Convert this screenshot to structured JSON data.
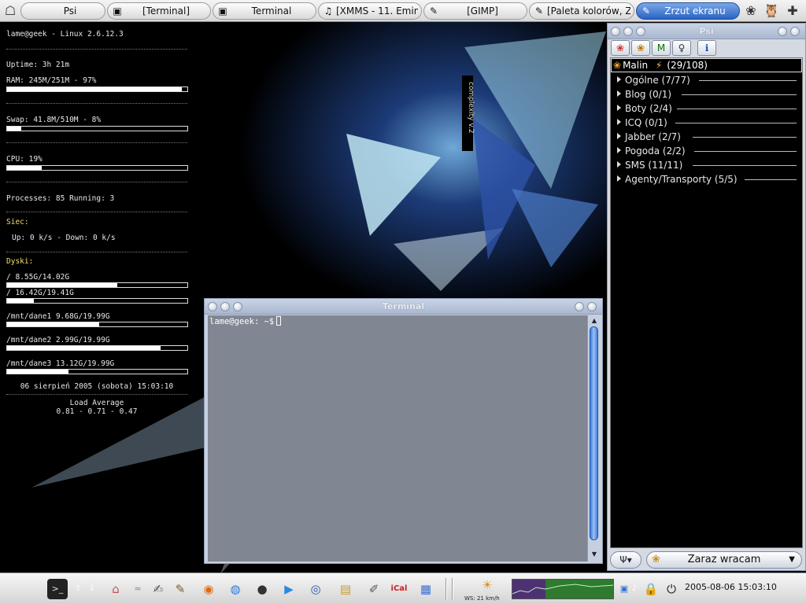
{
  "taskbar": {
    "tasks": [
      {
        "label": "Psi",
        "icon": "psi-icon"
      },
      {
        "label": "[Terminal]",
        "icon": "terminal-icon"
      },
      {
        "label": "Terminal",
        "icon": "terminal-icon"
      },
      {
        "label": "[XMMS - 11. Eminem",
        "icon": "xmms-icon"
      },
      {
        "label": "[GIMP]",
        "icon": "gimp-icon"
      },
      {
        "label": "[Paleta kolorów, Ze",
        "icon": "gimp-icon"
      },
      {
        "label": "Zrzut ekranu",
        "icon": "gimp-icon"
      }
    ]
  },
  "conky": {
    "header": "lame@geek - Linux 2.6.12.3",
    "uptime": "Uptime: 3h 21m",
    "ram": {
      "label": "RAM: 245M/251M - 97%",
      "percent": 97
    },
    "swap": {
      "label": "Swap: 41.8M/510M - 8%",
      "percent": 8
    },
    "cpu": {
      "label": "CPU: 19%",
      "percent": 19
    },
    "processes": "Processes: 85  Running: 3",
    "net_title": "Siec:",
    "net": "Up: 0 k/s - Down: 0 k/s",
    "disks_title": "Dyski:",
    "disks": [
      {
        "label": "/ 8.55G/14.02G",
        "percent": 61
      },
      {
        "label": "/ 16.42G/19.41G",
        "percent": 15
      },
      {
        "label": "/mnt/dane1 9.68G/19.99G",
        "percent": 51
      },
      {
        "label": "/mnt/dane2 2.99G/19.99G",
        "percent": 85
      },
      {
        "label": "/mnt/dane3 13.12G/19.99G",
        "percent": 34
      }
    ],
    "datetime": "06 sierpień 2005 (sobota) 15:03:10",
    "load_title": "Load Average",
    "load_values": "0.81 - 0.71 - 0.47"
  },
  "psi": {
    "title": "Psi",
    "account": "Malin",
    "account_count": "(29/108)",
    "groups": [
      "Ogólne (7/77)",
      "Blog (0/1)",
      "Boty (2/4)",
      "ICQ (0/1)",
      "Jabber (2/7)",
      "Pogoda (2/2)",
      "SMS (11/11)",
      "Agenty/Transporty (5/5)"
    ],
    "status": "Zaraz wracam"
  },
  "terminal": {
    "title": "Terminal",
    "prompt": "lame@geek: ~$"
  },
  "panel": {
    "weather": "WS: 21 km/h",
    "clock": "2005-08-06  15:03:10"
  }
}
